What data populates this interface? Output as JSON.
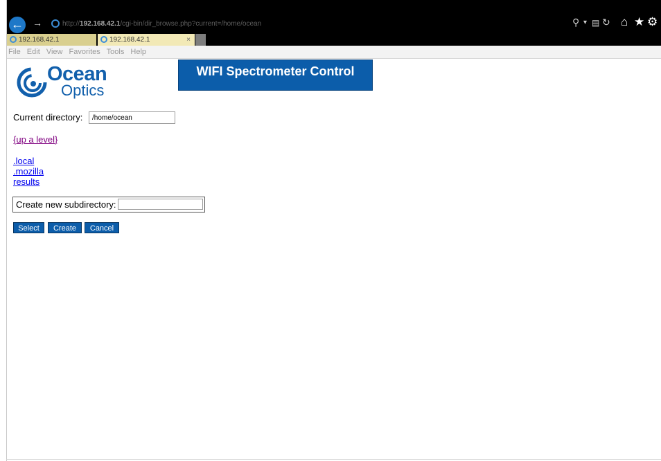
{
  "browser": {
    "address": {
      "prefix": "http://",
      "host": "192.168.42.1",
      "path": "/cgi-bin/dir_browse.php?current=/home/ocean"
    },
    "tabs": [
      {
        "label": "192.168.42.1"
      },
      {
        "label": "192.168.42.1",
        "close": "×"
      }
    ],
    "menu": [
      "File",
      "Edit",
      "View",
      "Favorites",
      "Tools",
      "Help"
    ],
    "nav_icons": [
      "back-arrow-icon",
      "forward-arrow-icon",
      "search-icon",
      "compatibility-icon",
      "refresh-icon",
      "home-icon",
      "favorites-star-icon",
      "settings-gear-icon"
    ]
  },
  "page": {
    "logo": {
      "line1": "Ocean",
      "line2": "Optics"
    },
    "banner": "WIFI Spectrometer Control",
    "current_dir_label": "Current directory:",
    "current_dir_value": "/home/ocean",
    "up_level": "{up a level}",
    "directories": [
      ".local",
      ".mozilla",
      "results"
    ],
    "new_subdir_label": "Create new subdirectory:",
    "new_subdir_value": "",
    "buttons": {
      "select": "Select",
      "create": "Create",
      "cancel": "Cancel"
    }
  },
  "colors": {
    "banner_bg": "#0c5daa",
    "button_bg": "#0c5daa",
    "visited_link": "#800080",
    "link": "#0000ee",
    "logo_blue": "#1260ac"
  }
}
